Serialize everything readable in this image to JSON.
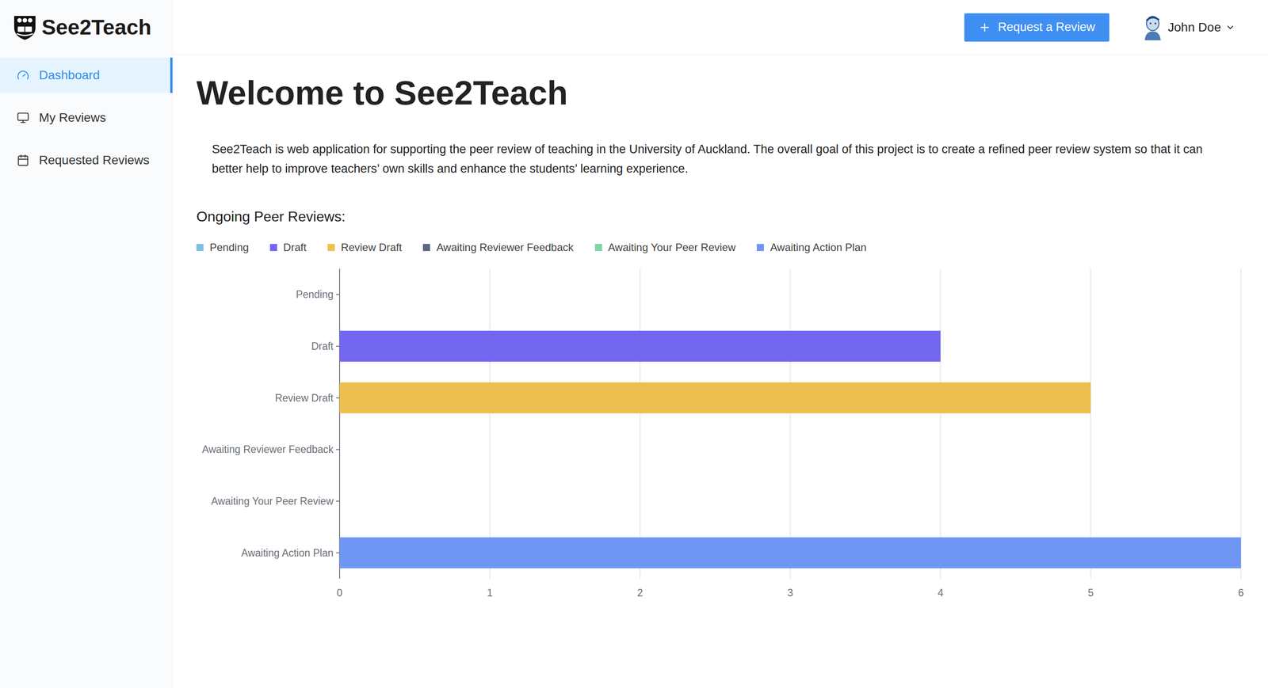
{
  "app": {
    "name": "See2Teach"
  },
  "header": {
    "request_button": {
      "icon": "+",
      "label": "Request a Review"
    },
    "user": {
      "name": "John Doe"
    }
  },
  "sidebar": {
    "items": [
      {
        "label": "Dashboard",
        "icon": "gauge",
        "selected": true
      },
      {
        "label": "My Reviews",
        "icon": "monitor",
        "selected": false
      },
      {
        "label": "Requested Reviews",
        "icon": "calendar",
        "selected": false
      }
    ]
  },
  "page": {
    "title": "Welcome to See2Teach",
    "description": "See2Teach is web application for supporting the peer review of teaching in the University of Auckland. The overall goal of this project is to create a refined peer review system so that it can better help to improve teachers’ own skills and enhance the students’ learning experience."
  },
  "chart": {
    "title": "Ongoing Peer Reviews:",
    "y_axis": {
      "labels": [
        "Pending",
        "Draft",
        "Review Draft",
        "Awaiting Reviewer Feedback",
        "Awaiting Your Peer Review",
        "Awaiting Action Plan"
      ]
    },
    "x_axis": {
      "ticks": [
        "0",
        "1",
        "2",
        "3",
        "4",
        "5",
        "6"
      ]
    },
    "series": [
      {
        "name": "Pending",
        "color": "#7ec0e4",
        "values": [
          0,
          0,
          0,
          0,
          0,
          0
        ]
      },
      {
        "name": "Draft",
        "color": "#7367f0",
        "values": [
          0,
          4,
          0,
          0,
          0,
          0
        ]
      },
      {
        "name": "Review Draft",
        "color": "#edbf4e",
        "values": [
          0,
          0,
          5,
          0,
          0,
          0
        ]
      },
      {
        "name": "Awaiting Reviewer Feedback",
        "color": "#5a6785",
        "values": [
          0,
          0,
          0,
          0,
          0,
          0
        ]
      },
      {
        "name": "Awaiting Your Peer Review",
        "color": "#7fd4a6",
        "values": [
          0,
          0,
          0,
          0,
          0,
          0
        ]
      },
      {
        "name": "Awaiting Action Plan",
        "color": "#6f96f2",
        "values": [
          0,
          0,
          0,
          0,
          0,
          6
        ]
      }
    ]
  }
}
